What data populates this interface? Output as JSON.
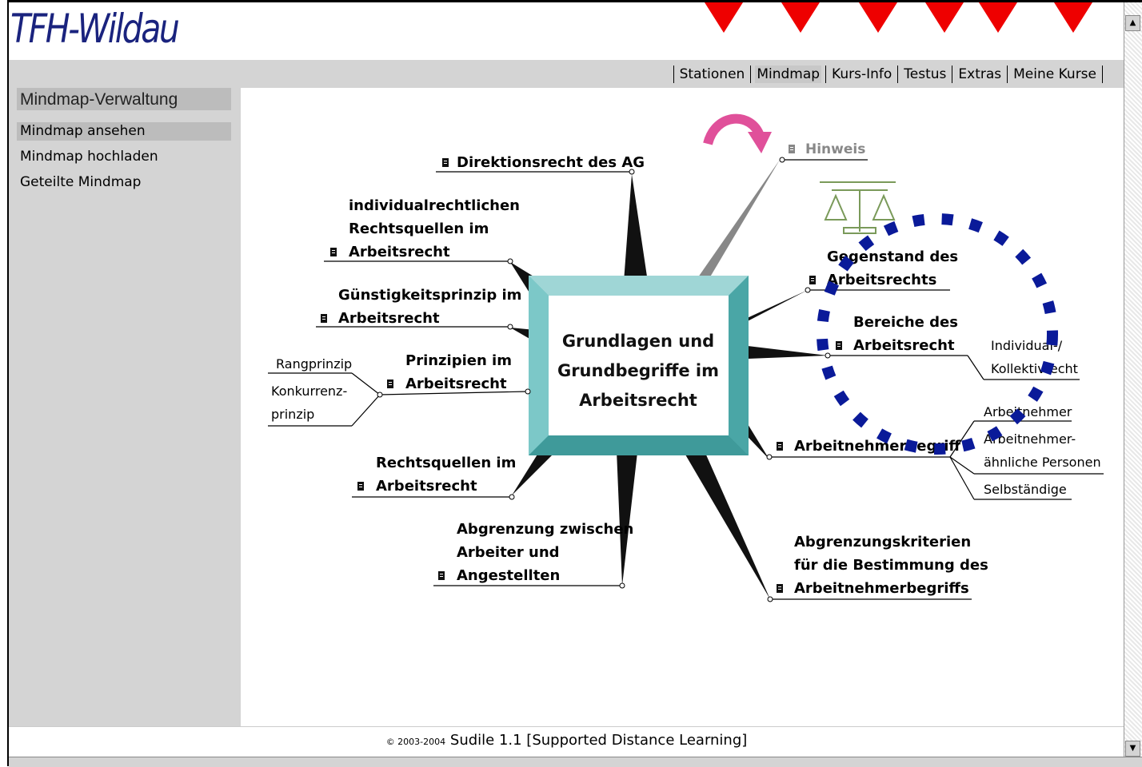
{
  "header": {
    "logo": "TFH-Wildau"
  },
  "nav": {
    "items": [
      {
        "label": "Stationen",
        "active": false
      },
      {
        "label": "Mindmap",
        "active": true
      },
      {
        "label": "Kurs-Info",
        "active": false
      },
      {
        "label": "Testus",
        "active": false
      },
      {
        "label": "Extras",
        "active": false
      },
      {
        "label": "Meine Kurse",
        "active": false
      }
    ]
  },
  "sidebar": {
    "title": "Mindmap-Verwaltung",
    "items": [
      {
        "label": "Mindmap ansehen",
        "active": true
      },
      {
        "label": "Mindmap hochladen",
        "active": false
      },
      {
        "label": "Geteilte Mindmap",
        "active": false
      }
    ]
  },
  "mindmap": {
    "center": [
      "Grundlagen und",
      "Grundbegriffe im",
      "Arbeitsrecht"
    ],
    "hint": "Hinweis",
    "branches": {
      "direktion": [
        "Direktionsrecht des AG"
      ],
      "individual": [
        "individualrechtlichen",
        "Rechtsquellen im",
        "Arbeitsrecht"
      ],
      "guenstig": [
        "Günstigkeitsprinzip im",
        "Arbeitsrecht"
      ],
      "prinzipien": [
        "Prinzipien im",
        "Arbeitsrecht"
      ],
      "rechtsquellen": [
        "Rechtsquellen im",
        "Arbeitsrecht"
      ],
      "abgrenzung": [
        "Abgrenzung zwischen",
        "Arbeiter und",
        "Angestellten"
      ],
      "gegenstand": [
        "Gegenstand des",
        "Arbeitsrechts"
      ],
      "bereiche": [
        "Bereiche des",
        "Arbeitsrecht"
      ],
      "arbeitnehmerbegriff": [
        "Arbeitnehmerbegriff"
      ],
      "kriterien": [
        "Abgrenzungskriterien",
        "für die Bestimmung des",
        "Arbeitnehmerbegriffs"
      ]
    },
    "sub": {
      "rangprinzip": "Rangprinzip",
      "konkurrenz": [
        "Konkurrenz-",
        "prinzip"
      ],
      "individual_kollektiv": [
        "Individual-/",
        "Kollektivrecht"
      ],
      "arbeitnehmer": "Arbeitnehmer",
      "arbeitnehmeraehnlich": [
        "Arbeitnehmer-",
        "ähnliche Personen"
      ],
      "selbstaendige": "Selbständige"
    }
  },
  "footer": {
    "copyright": "© 2003-2004",
    "product": "Sudile 1.1 [Supported Distance Learning]"
  },
  "colors": {
    "accent_arrow": "#ee0000",
    "annotation_circle": "#0a1a99",
    "center_box": "#5fb8b8",
    "hint_arrow": "#e0509a"
  }
}
